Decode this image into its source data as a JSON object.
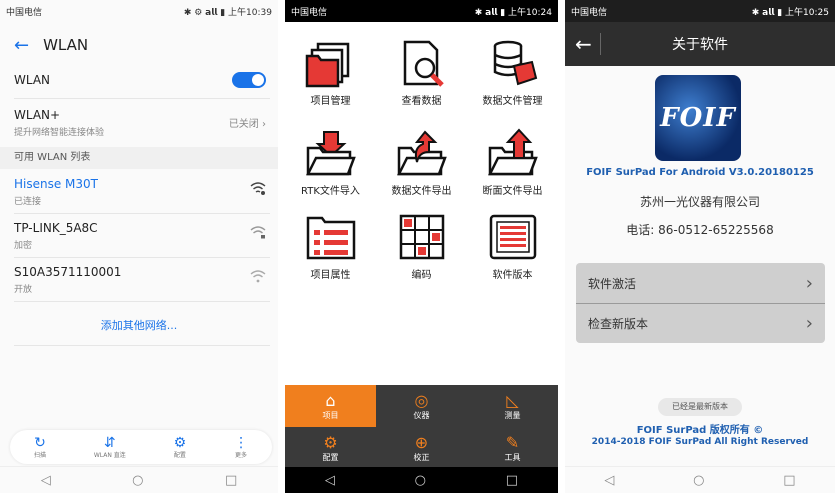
{
  "left": {
    "status": {
      "carrier": "中国电信",
      "right": "✱ ⚙ 𝗮𝗹𝗹 ▮ 上午10:39"
    },
    "header": {
      "back": "←",
      "title": "WLAN"
    },
    "wlan": {
      "label": "WLAN"
    },
    "wlan_plus": {
      "title": "WLAN+",
      "subtitle": "提升网络智能连接体验",
      "value": "已关闭 ›"
    },
    "list_header": "可用 WLAN 列表",
    "networks": [
      {
        "name": "Hisense M30T",
        "status": "已连接",
        "connected": true
      },
      {
        "name": "TP-LINK_5A8C",
        "status": "加密",
        "connected": false
      },
      {
        "name": "S10A3571110001",
        "status": "开放",
        "connected": false
      }
    ],
    "add_network": "添加其他网络...",
    "dock": [
      {
        "icon": "refresh-icon",
        "glyph": "↻",
        "label": "扫描"
      },
      {
        "icon": "wifi-direct-icon",
        "glyph": "⇵",
        "label": "WLAN 直连"
      },
      {
        "icon": "settings-icon",
        "glyph": "⚙",
        "label": "配置"
      },
      {
        "icon": "more-icon",
        "glyph": "⋮",
        "label": "更多"
      }
    ],
    "nav": {
      "back": "◁",
      "home": "○",
      "recent": "□"
    }
  },
  "middle": {
    "status": {
      "carrier": "中国电信",
      "right": "✱ 𝗮𝗹𝗹 ▮ 上午10:24"
    },
    "grid": [
      {
        "name": "project-manage",
        "label": "项目管理"
      },
      {
        "name": "view-data",
        "label": "查看数据"
      },
      {
        "name": "data-file-manage",
        "label": "数据文件管理"
      },
      {
        "name": "rtk-import",
        "label": "RTK文件导入"
      },
      {
        "name": "data-export",
        "label": "数据文件导出"
      },
      {
        "name": "section-export",
        "label": "断面文件导出"
      },
      {
        "name": "project-properties",
        "label": "项目属性"
      },
      {
        "name": "code",
        "label": "编码"
      },
      {
        "name": "software-version",
        "label": "软件版本"
      }
    ],
    "tabs": [
      {
        "name": "project",
        "glyph": "⌂",
        "label": "项目",
        "active": true
      },
      {
        "name": "instrument",
        "glyph": "◎",
        "label": "仪器",
        "active": false
      },
      {
        "name": "measure",
        "glyph": "◺",
        "label": "测量",
        "active": false
      },
      {
        "name": "config",
        "glyph": "⚙",
        "label": "配置",
        "active": false
      },
      {
        "name": "calibrate",
        "glyph": "⊕",
        "label": "校正",
        "active": false
      },
      {
        "name": "tools",
        "glyph": "✎",
        "label": "工具",
        "active": false
      }
    ],
    "nav": {
      "back": "◁",
      "home": "○",
      "recent": "□"
    }
  },
  "right": {
    "status": {
      "carrier": "中国电信",
      "right": "✱ 𝗮𝗹𝗹 ▮ 上午10:25"
    },
    "header": {
      "back": "←",
      "title": "关于软件"
    },
    "logo_text": "FOIF",
    "product": "FOIF SurPad For Android V3.0.20180125",
    "company": "苏州一光仪器有限公司",
    "phone": "电话: 86-0512-65225568",
    "menu": [
      {
        "label": "软件激活",
        "arrow": "›"
      },
      {
        "label": "检查新版本",
        "arrow": "›"
      }
    ],
    "latest": "已经是最新版本",
    "copyright1": "FOIF SurPad 版权所有 ©",
    "copyright2": "2014-2018 FOIF SurPad All Right Reserved",
    "nav": {
      "back": "◁",
      "home": "○",
      "recent": "□"
    },
    "colors": {
      "accent": "#1f5fb0",
      "header": "#2e2e2e",
      "menu": "#cfcfcf"
    }
  },
  "colors": {
    "wlan_blue": "#1a73e8",
    "icon_red": "#e53935",
    "tab_orange": "#f07f1e",
    "tab_dark": "#3a3a3a"
  }
}
